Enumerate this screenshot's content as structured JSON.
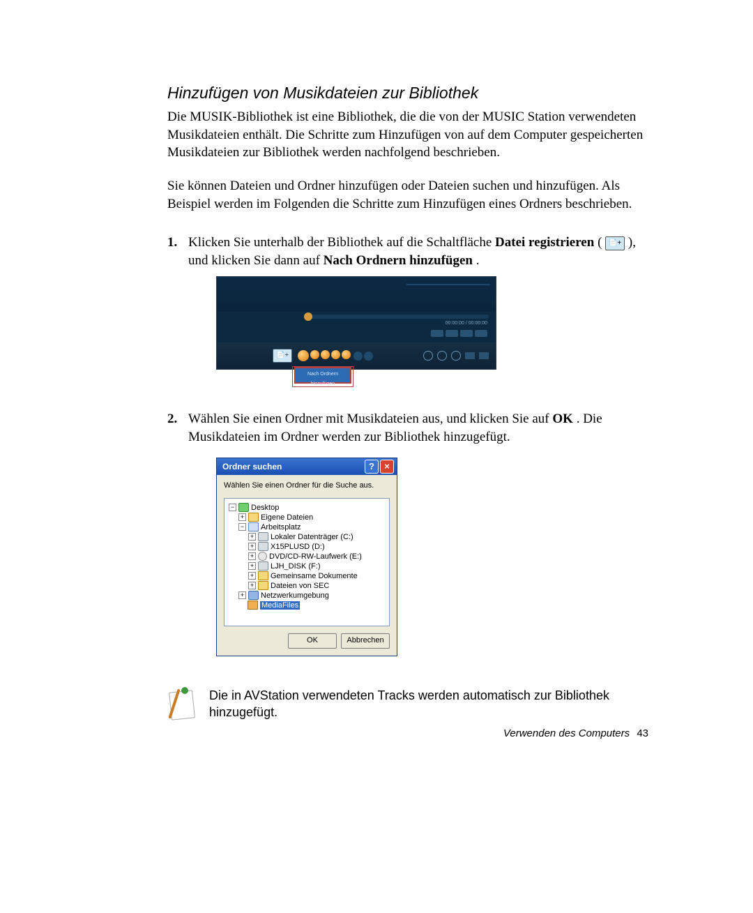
{
  "heading": "Hinzufügen von Musikdateien zur Bibliothek",
  "para1": "Die MUSIK-Bibliothek ist eine Bibliothek, die die von der MUSIC Station verwendeten Musikdateien enthält. Die Schritte zum Hinzufügen von auf dem Computer gespeicherten Musikdateien zur Bibliothek werden nachfolgend beschrieben.",
  "para2": "Sie können Dateien und Ordner hinzufügen oder Dateien suchen und hinzufügen. Als Beispiel werden im Folgenden die Schritte zum Hinzufügen eines Ordners beschrieben.",
  "step1": {
    "num": "1.",
    "pre": "Klicken Sie unterhalb der Bibliothek auf die Schaltfläche ",
    "bold1": "Datei registrieren",
    "mid": " ( ",
    "mid2": " ), und klicken Sie dann auf ",
    "bold2": "Nach Ordnern hinzufügen",
    "end": "."
  },
  "player": {
    "time": "00:00:00 / 00:00:00",
    "menu_label": "Nach Ordnern hinzufügen"
  },
  "step2": {
    "num": "2.",
    "pre": "Wählen Sie einen Ordner mit Musikdateien aus, und klicken Sie auf ",
    "bold1": "OK",
    "post": ". Die Musikdateien im Ordner werden zur Bibliothek hinzugefügt."
  },
  "browse": {
    "title": "Ordner suchen",
    "help": "?",
    "close": "×",
    "instruction": "Wählen Sie einen Ordner für die Suche aus.",
    "tree": {
      "desktop": "Desktop",
      "eigene": "Eigene Dateien",
      "arbeitsplatz": "Arbeitsplatz",
      "c": "Lokaler Datenträger (C:)",
      "d": "X15PLUSD (D:)",
      "e": "DVD/CD-RW-Laufwerk (E:)",
      "f": "LJH_DISK (F:)",
      "gemeinsame": "Gemeinsame Dokumente",
      "sec": "Dateien von SEC",
      "netz": "Netzwerkumgebung",
      "media": "MediaFiles"
    },
    "ok": "OK",
    "cancel": "Abbrechen"
  },
  "note": "Die in AVStation verwendeten Tracks werden automatisch zur Bibliothek hinzugefügt.",
  "footer": {
    "text": "Verwenden des Computers",
    "page": "43"
  }
}
